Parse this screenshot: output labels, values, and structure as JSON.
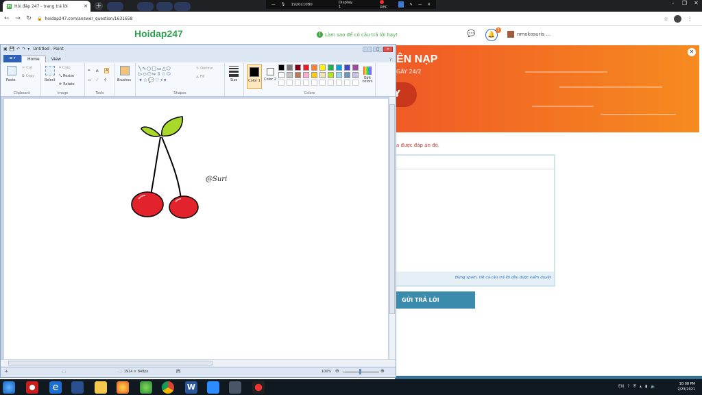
{
  "browser": {
    "tab_title": "Hỏi đáp 247 - trang trả lời",
    "url": "hoidap247.com/answer_question/1631658",
    "recording": {
      "resolution": "1920x1080",
      "display": "Display 1",
      "rec": "REC"
    }
  },
  "site": {
    "logo": "Hoidap247",
    "tip": "Làm sao để có câu trả lời hay!",
    "notification_count": "1",
    "username": "nmokosuris ...",
    "banner_title": "ÊN NẠP",
    "banner_subtitle": "GÀY 24/2",
    "banner_button": "Y",
    "notice": "a được đáp án đó.",
    "editor_footer": "Đừng spam, tất cả câu trả lời đều được kiểm duyệt",
    "submit_label": "GỬI TRẢ LỜI"
  },
  "paint": {
    "title": "Untitled - Paint",
    "tabs": [
      "Home",
      "View"
    ],
    "groups": {
      "clipboard": "Clipboard",
      "image": "Image",
      "tools": "Tools",
      "shapes": "Shapes",
      "colors": "Colors"
    },
    "buttons": {
      "paste": "Paste",
      "cut": "Cut",
      "copy": "Copy",
      "select": "Select",
      "crop": "Crop",
      "resize": "Resize",
      "rotate": "Rotate",
      "brushes": "Brushes",
      "outline": "Outline",
      "fill": "Fill",
      "size": "Size",
      "color1": "Color 1",
      "color2": "Color 2",
      "edit_colors": "Edit colors"
    },
    "canvas_text": "@Suri",
    "status_size": "1914 × 848px",
    "zoom": "100%",
    "palette": [
      "#000000",
      "#7f7f7f",
      "#880015",
      "#ed1c24",
      "#ff7f27",
      "#fff200",
      "#22b14c",
      "#00a2e8",
      "#3f48cc",
      "#a349a4",
      "#ffffff",
      "#c3c3c3",
      "#b97a57",
      "#ffaec9",
      "#ffc90e",
      "#efe4b0",
      "#b5e61d",
      "#99d9ea",
      "#7092be",
      "#c8bfe7"
    ],
    "drawing_colors": {
      "cherry": "#e3232c",
      "leaf": "#a7d82a",
      "stem": "#000000"
    }
  },
  "taskbar": {
    "time": "10:08 PM",
    "date": "2/23/2021"
  }
}
